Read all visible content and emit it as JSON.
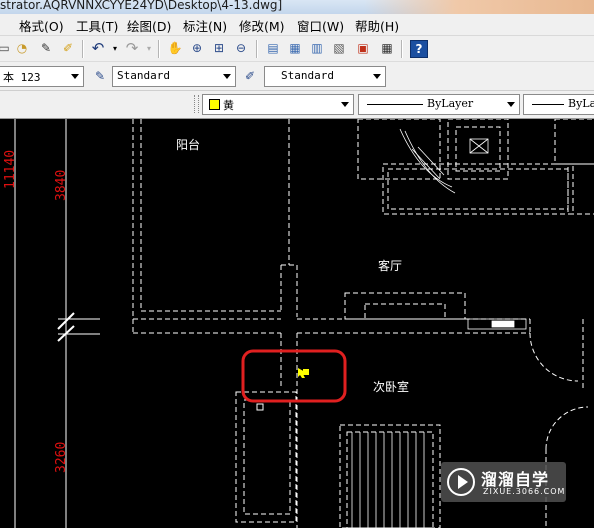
{
  "window": {
    "title": "strator.AQRVNNXCYYE24YD\\Desktop\\4-13.dwg]"
  },
  "menubar": {
    "items": [
      "格式(O)",
      "工具(T)",
      "绘图(D)",
      "标注(N)",
      "修改(M)",
      "窗口(W)",
      "帮助(H)"
    ]
  },
  "toolbar2": {
    "text_style": "本 123",
    "dim_style": "Standard",
    "table_style": "Standard"
  },
  "toolbar3": {
    "color": "黄",
    "linetype": "ByLayer",
    "lineweight": "ByLa"
  },
  "drawing": {
    "dimensions": {
      "d1": "11140",
      "d2": "3840",
      "d3": "3260"
    },
    "rooms": {
      "balcony": "阳台",
      "living": "客厅",
      "bedroom": "次卧室"
    }
  },
  "watermark": {
    "title": "溜溜自学",
    "subtitle": "ZIXUE.3066.COM"
  },
  "colors": {
    "canvas_bg": "#000000",
    "cad_line": "#ffffff",
    "dimension_text": "#e01010",
    "highlight": "#e02020",
    "cursor": "#ffff00",
    "color_swatch": "#ffff00"
  }
}
